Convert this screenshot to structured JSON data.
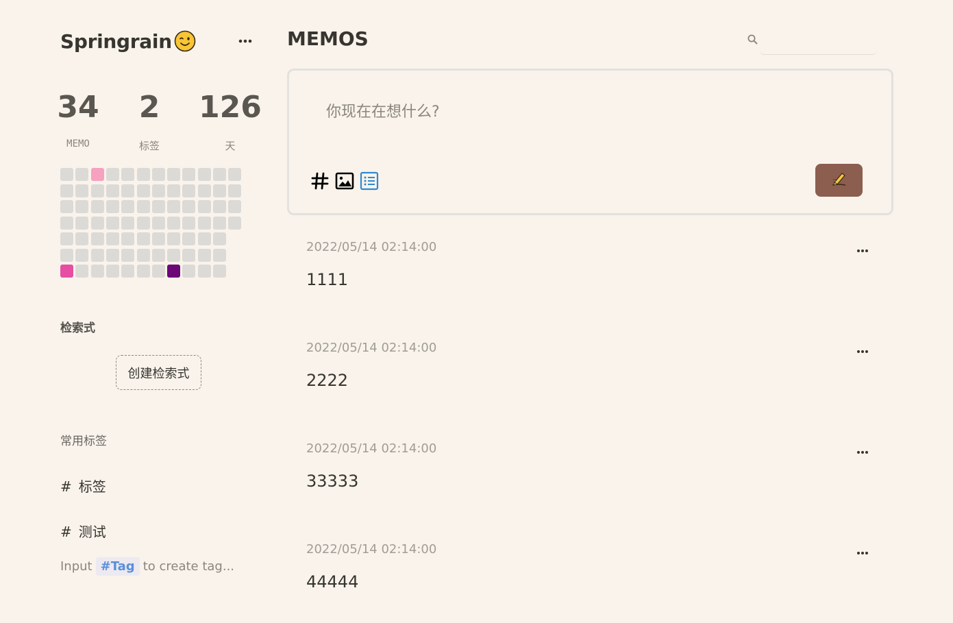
{
  "sidebar": {
    "username": "Springrain",
    "user_emoji": "winking-face-icon",
    "stats": [
      {
        "value": "34",
        "label": "MEMO"
      },
      {
        "value": "2",
        "label": "标签"
      },
      {
        "value": "126",
        "label": "天"
      }
    ],
    "heatmap": {
      "colors": {
        "empty": "#dcdad6",
        "light_pink": "#f7a1c0",
        "pink": "#e74da2",
        "purple": "#6b0777"
      }
    },
    "queries_title": "检索式",
    "create_query_label": "创建检索式",
    "tags_title": "常用标签",
    "tags": [
      {
        "hash": "#",
        "label": "标签"
      },
      {
        "hash": "#",
        "label": "测试"
      }
    ],
    "tag_hint": {
      "prefix": "Input",
      "badge": "#Tag",
      "suffix": "to create tag..."
    }
  },
  "main": {
    "title": "MEMOS",
    "search": {
      "placeholder": "",
      "icon": "search-icon"
    },
    "editor": {
      "placeholder": "你现在在想什么?",
      "tools": [
        "hashtag-icon",
        "image-icon",
        "list-icon"
      ],
      "submit_icon": "pen-writing-icon"
    },
    "memos": [
      {
        "time": "2022/05/14 02:14:00",
        "content": "1111"
      },
      {
        "time": "2022/05/14 02:14:00",
        "content": "2222"
      },
      {
        "time": "2022/05/14 02:14:00",
        "content": "33333"
      },
      {
        "time": "2022/05/14 02:14:00",
        "content": "44444"
      }
    ]
  },
  "colors": {
    "background": "#f9f3eb",
    "accent_button": "#8b5e4f",
    "tag_blue": "#5b8fd9",
    "list_icon_blue": "#2d8ad2"
  }
}
